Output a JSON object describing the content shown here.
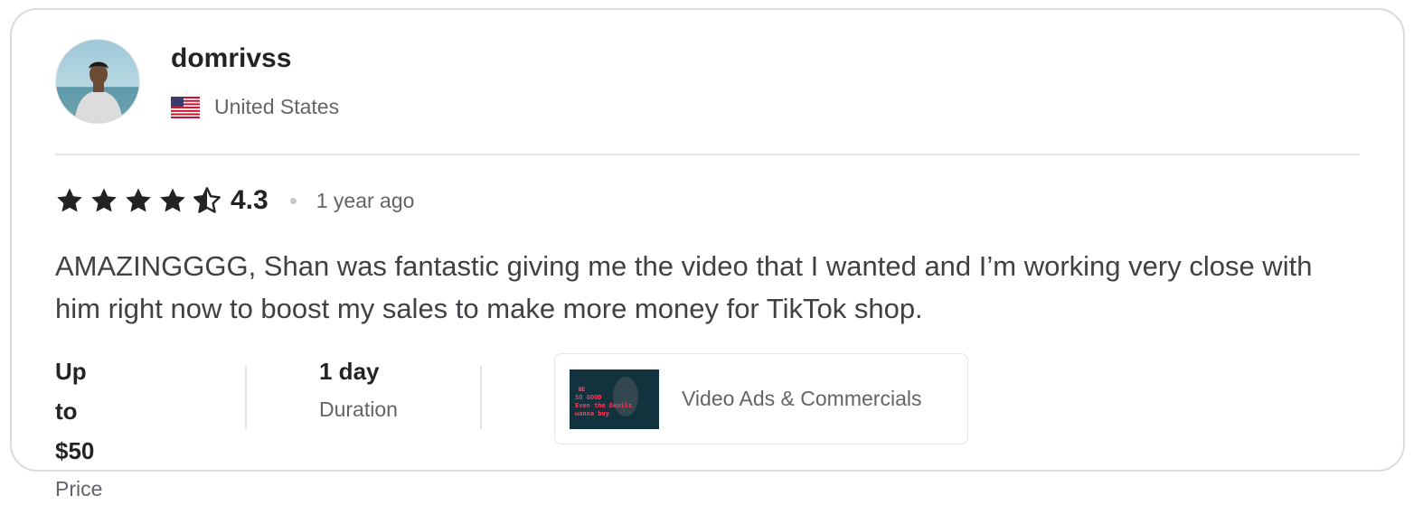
{
  "reviewer": {
    "username": "domrivss",
    "country": "United States",
    "avatar_icon": "reviewer-avatar",
    "flag_icon": "us-flag-icon"
  },
  "review": {
    "rating": "4.3",
    "rating_value": 4.3,
    "stars": [
      "star-full-icon",
      "star-full-icon",
      "star-full-icon",
      "star-full-icon",
      "star-half-icon"
    ],
    "time_ago": "1 year ago",
    "text": "AMAZINGGGG, Shan was fantastic giving me the video that I wanted and I’m working very close with him right now to boost my sales to make more money for TikTok shop."
  },
  "details": {
    "price_value": "Up to $50",
    "price_label": "Price",
    "duration_value": "1 day",
    "duration_label": "Duration"
  },
  "service": {
    "name": "Video Ads & Commercials",
    "thumbnail_lines": [
      "BE",
      "SO GOOD",
      "Even the Devils",
      "wanna buy"
    ]
  },
  "colors": {
    "text_primary": "#222325",
    "text_secondary": "#62646a",
    "border": "#dadbdd",
    "star": "#222325"
  }
}
